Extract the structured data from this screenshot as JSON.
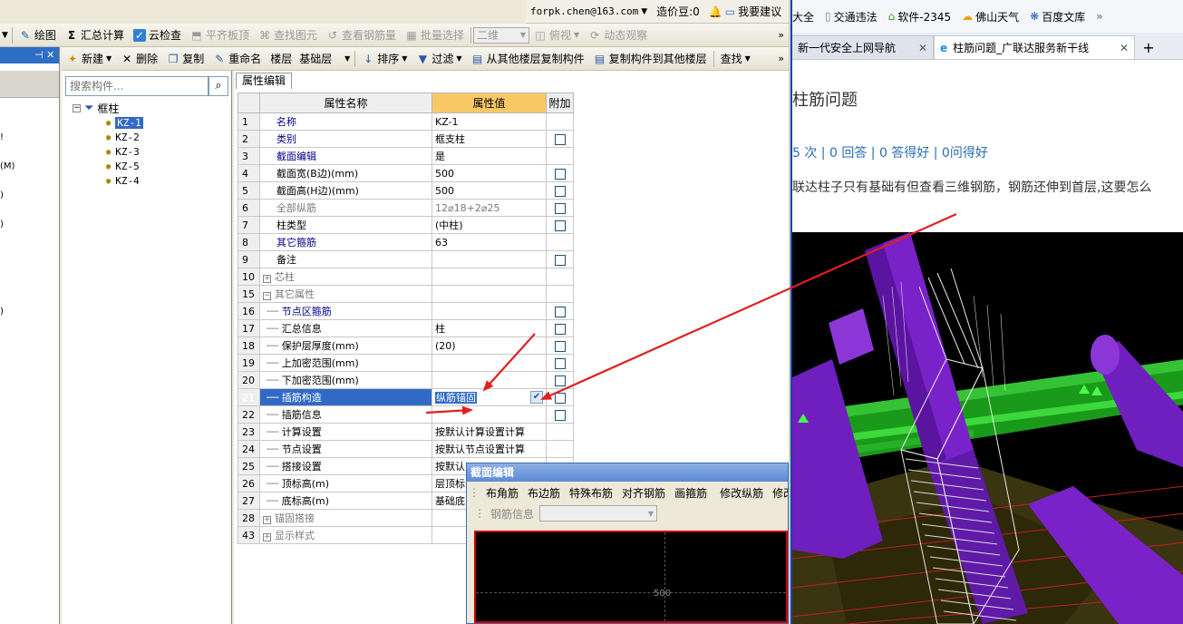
{
  "info_bar": {
    "email": "forpk.chen@163.com",
    "price_label": "造价豆:0",
    "suggest_label": "我要建议"
  },
  "main_toolbar": {
    "items": [
      {
        "label": "绘图",
        "disabled": false
      },
      {
        "label": "汇总计算",
        "disabled": false
      },
      {
        "label": "云检查",
        "disabled": false
      },
      {
        "label": "平齐板顶",
        "disabled": true
      },
      {
        "label": "查找图元",
        "disabled": true
      },
      {
        "label": "查看钢筋量",
        "disabled": true
      },
      {
        "label": "批量选择",
        "disabled": true
      }
    ],
    "view_combo": "二维",
    "view_items": [
      {
        "label": "俯视",
        "disabled": true
      },
      {
        "label": "动态观察",
        "disabled": true
      }
    ]
  },
  "component_toolbar": {
    "items": [
      "新建",
      "删除",
      "复制",
      "重命名"
    ],
    "floor_label": "楼层",
    "floor_value": "基础层",
    "sort": "排序",
    "filter": "过滤",
    "copy_from": "从其他楼层复制构件",
    "copy_to": "复制构件到其他楼层",
    "find": "查找"
  },
  "left_panel": {
    "ticks": [
      "!",
      "(M)",
      ")",
      ")",
      ")"
    ]
  },
  "tree": {
    "search_placeholder": "搜索构件...",
    "root": "框柱",
    "children": [
      "KZ-1",
      "KZ-2",
      "KZ-3",
      "KZ-5",
      "KZ-4"
    ],
    "selected": "KZ-1"
  },
  "property_panel": {
    "tab": "属性编辑",
    "headers": {
      "name": "属性名称",
      "value": "属性值",
      "extra": "附加"
    },
    "rows": [
      {
        "num": "1",
        "name": "名称",
        "value": "KZ-1",
        "style": "blue",
        "check": false,
        "indent": 0
      },
      {
        "num": "2",
        "name": "类别",
        "value": "框支柱",
        "style": "blue",
        "check": true,
        "indent": 0
      },
      {
        "num": "3",
        "name": "截面编辑",
        "value": "是",
        "style": "blue",
        "check": false,
        "indent": 0
      },
      {
        "num": "4",
        "name": "截面宽(B边)(mm)",
        "value": "500",
        "style": "",
        "check": true,
        "indent": 0
      },
      {
        "num": "5",
        "name": "截面高(H边)(mm)",
        "value": "500",
        "style": "",
        "check": true,
        "indent": 0
      },
      {
        "num": "6",
        "name": "全部纵筋",
        "value": "12⌀18+2⌀25",
        "style": "gray",
        "check": true,
        "indent": 0
      },
      {
        "num": "7",
        "name": "柱类型",
        "value": "(中柱)",
        "style": "",
        "check": true,
        "indent": 0
      },
      {
        "num": "8",
        "name": "其它箍筋",
        "value": "63",
        "style": "blue",
        "check": false,
        "indent": 0
      },
      {
        "num": "9",
        "name": "备注",
        "value": "",
        "style": "",
        "check": true,
        "indent": 0
      },
      {
        "num": "10",
        "name": "芯柱",
        "value": "",
        "style": "gray",
        "check": false,
        "indent": 0,
        "expander": "+"
      },
      {
        "num": "15",
        "name": "其它属性",
        "value": "",
        "style": "gray",
        "check": false,
        "indent": 0,
        "expander": "−"
      },
      {
        "num": "16",
        "name": "节点区箍筋",
        "value": "",
        "style": "blue",
        "check": true,
        "indent": 1
      },
      {
        "num": "17",
        "name": "汇总信息",
        "value": "柱",
        "style": "",
        "check": true,
        "indent": 1
      },
      {
        "num": "18",
        "name": "保护层厚度(mm)",
        "value": "(20)",
        "style": "",
        "check": true,
        "indent": 1
      },
      {
        "num": "19",
        "name": "上加密范围(mm)",
        "value": "",
        "style": "",
        "check": true,
        "indent": 1
      },
      {
        "num": "20",
        "name": "下加密范围(mm)",
        "value": "",
        "style": "",
        "check": true,
        "indent": 1
      },
      {
        "num": "21",
        "name": "插筋构造",
        "value": "纵筋锚固",
        "style": "",
        "check": true,
        "indent": 1,
        "selected": true
      },
      {
        "num": "22",
        "name": "插筋信息",
        "value": "",
        "style": "",
        "check": true,
        "indent": 1
      },
      {
        "num": "23",
        "name": "计算设置",
        "value": "按默认计算设置计算",
        "style": "",
        "check": false,
        "indent": 1
      },
      {
        "num": "24",
        "name": "节点设置",
        "value": "按默认节点设置计算",
        "style": "",
        "check": false,
        "indent": 1
      },
      {
        "num": "25",
        "name": "搭接设置",
        "value": "按默认",
        "style": "",
        "check": false,
        "indent": 1
      },
      {
        "num": "26",
        "name": "顶标高(m)",
        "value": "层顶标",
        "style": "",
        "check": false,
        "indent": 1
      },
      {
        "num": "27",
        "name": "底标高(m)",
        "value": "基础底",
        "style": "",
        "check": false,
        "indent": 1
      },
      {
        "num": "28",
        "name": "锚固搭接",
        "value": "",
        "style": "gray",
        "check": false,
        "indent": 0,
        "expander": "+"
      },
      {
        "num": "43",
        "name": "显示样式",
        "value": "",
        "style": "gray",
        "check": false,
        "indent": 0,
        "expander": "+"
      }
    ]
  },
  "section_window": {
    "title": "截面编辑",
    "tools": [
      "布角筋",
      "布边筋",
      "特殊布筋",
      "对齐钢筋",
      "画箍筋",
      "修改纵筋",
      "修改"
    ],
    "rebar_info_label": "钢筋信息",
    "dimension": "500"
  },
  "browser": {
    "bookmarks": [
      "大全",
      "交通违法",
      "软件-2345",
      "佛山天气",
      "百度文库"
    ],
    "tabs": [
      {
        "label": "新一代安全上网导航",
        "active": false
      },
      {
        "label": "柱筋问题_广联达服务新干线",
        "active": true
      }
    ],
    "page_title": "柱筋问题",
    "stats": "5 次 | 0 回答 | 0 答得好 | 0问得好",
    "question": "联达柱子只有基础有但查看三维钢筋，钢筋还伸到首层,这要怎么"
  },
  "colors": {
    "selection": "#316ac5",
    "value_header": "#f8c867",
    "annotation_arrow": "#e02020",
    "link_blue": "#2a6bb5"
  }
}
